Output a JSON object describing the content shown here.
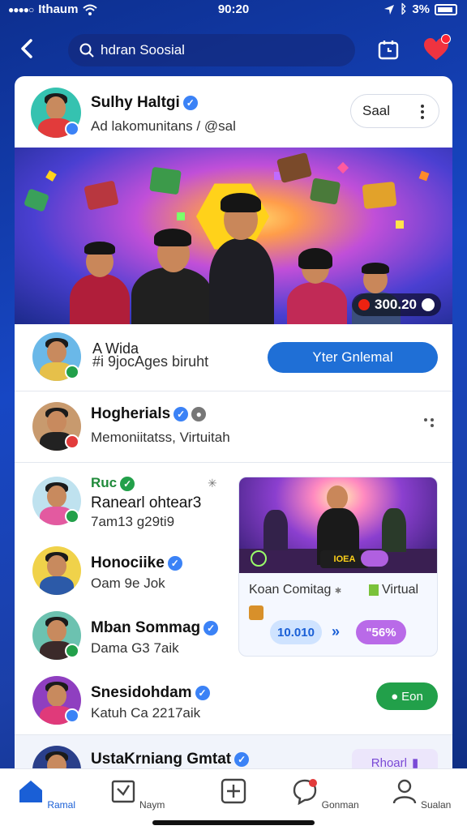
{
  "status_bar": {
    "carrier": "Ithaum",
    "time": "90:20",
    "battery": "3%"
  },
  "header": {
    "search_text": "hdran Soosial"
  },
  "post": {
    "author": "Sulhy Haltgi",
    "subtitle": "Ad lakomunitans / @sal",
    "follow_label": "Saal",
    "live_count": "300.20"
  },
  "promo_row": {
    "title": "A Wida",
    "subtitle": "#i 9jocAges biruht",
    "button_label": "Yter Gnlemal"
  },
  "list": [
    {
      "name": "Hogherials",
      "sub": "Memoniitatss, Virtuitah"
    },
    {
      "name": "Ruc",
      "sub2": "Ranearl ohtear3",
      "sub": "7am13 g29ti9"
    },
    {
      "name": "Honociike",
      "sub": "Oam 9e Jok"
    },
    {
      "name": "Mban Sommag",
      "sub": "Dama G3 7aik"
    },
    {
      "name": "Snesidohdam",
      "sub": "Katuh Ca 2217aik",
      "button_label": "Eon"
    },
    {
      "name": "UstaKrniang Gmtat",
      "button_label": "Rhoarl"
    }
  ],
  "promo_card": {
    "image_label": "IOEA",
    "title": "Koan Comitag",
    "tag": "Virtual",
    "stat_1": "10.010",
    "stat_2": "\"56%"
  },
  "bottom_nav": {
    "items": [
      {
        "label": "Ramal"
      },
      {
        "label": "Naym"
      },
      {
        "label": ""
      },
      {
        "label": "Gonman"
      },
      {
        "label": "Sualan"
      }
    ]
  },
  "colors": {
    "accent": "#1a5fd6",
    "brand_bg": "#1747c4",
    "verified": "#3b82f6",
    "green": "#22a04a",
    "purple": "#b060e0"
  }
}
